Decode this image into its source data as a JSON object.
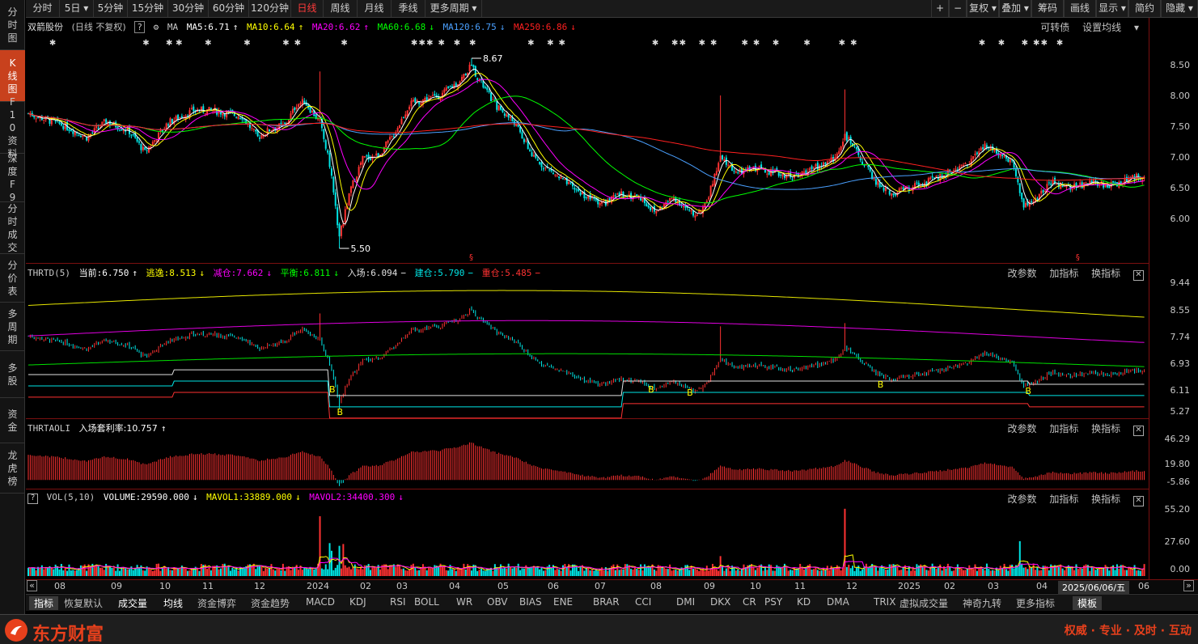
{
  "toolbar": {
    "periods": [
      "分时",
      "5日",
      "5分钟",
      "15分钟",
      "30分钟",
      "60分钟",
      "120分钟",
      "日线",
      "周线",
      "月线",
      "季线",
      "更多周期"
    ],
    "active_period": "日线",
    "right_items": [
      "+",
      "−",
      "复权",
      "叠加",
      "筹码",
      "画线",
      "显示",
      "简约",
      "隐藏"
    ]
  },
  "sidebar": [
    "分时图",
    "K线图",
    "F10资料",
    "深度F9",
    "分时成交",
    "分价表",
    "多周期",
    "多股",
    "资金",
    "龙虎榜"
  ],
  "kline": {
    "title": "双箭股份",
    "mode": "(日线 不复权)",
    "ma_label": "MA",
    "ma5": "MA5:6.71",
    "ma10": "MA10:6.64",
    "ma20": "MA20:6.62",
    "ma60": "MA60:6.68",
    "ma120": "MA120:6.75",
    "ma250": "MA250:6.86",
    "right1": "可转债",
    "right2": "设置均线",
    "high_mark": "8.67",
    "low_mark": "5.50",
    "axis": [
      "8.50",
      "8.00",
      "7.50",
      "7.00",
      "6.50",
      "6.00"
    ],
    "colors": {
      "up": "#ff3232",
      "down": "#00e5e5",
      "ma5": "#ffffff",
      "ma10": "#ffff00",
      "ma20": "#ff00ff",
      "ma60": "#00ff00",
      "ma120": "#4aa0ff",
      "ma250": "#ff2020"
    }
  },
  "thrtd": {
    "name": "THRTD(5)",
    "current": "当前:6.750",
    "escape": "逃逸:8.513",
    "reduce": "减仓:7.662",
    "balance": "平衡:6.811",
    "enter": "入场:6.094",
    "build": "建仓:5.790",
    "heavy": "重仓:5.485",
    "tools": [
      "改参数",
      "加指标",
      "换指标"
    ],
    "axis": [
      "9.44",
      "8.55",
      "7.74",
      "6.93",
      "6.11",
      "5.27"
    ],
    "b_marks": [
      "B",
      "B",
      "B",
      "B",
      "B",
      "B"
    ]
  },
  "thrtaoli": {
    "name": "THRTAOLI",
    "rate": "入场套利率:10.757",
    "tools": [
      "改参数",
      "加指标",
      "换指标"
    ],
    "axis": [
      "46.29",
      "19.80",
      "-5.86"
    ]
  },
  "vol": {
    "name": "VOL(5,10)",
    "volume": "VOLUME:29590.000",
    "mavol1": "MAVOL1:33889.000",
    "mavol2": "MAVOL2:34400.300",
    "tools": [
      "改参数",
      "加指标",
      "换指标"
    ],
    "axis": [
      "55.20",
      "27.60",
      "0.00"
    ]
  },
  "dateaxis": [
    "08",
    "09",
    "10",
    "11",
    "12",
    "2024",
    "02",
    "03",
    "04",
    "05",
    "06",
    "07",
    "08",
    "09",
    "10",
    "11",
    "12",
    "2025",
    "02",
    "03",
    "04",
    "06"
  ],
  "current_date": "2025/06/06/五",
  "indicators": [
    "指标",
    "恢复默认",
    "成交量",
    "均线",
    "资金博弈",
    "资金趋势",
    "MACD",
    "KDJ",
    "RSI",
    "BOLL",
    "WR",
    "OBV",
    "BIAS",
    "ENE",
    "BRAR",
    "CCI",
    "DMI",
    "DKX",
    "CR",
    "PSY",
    "KD",
    "DMA",
    "TRIX",
    "虚拟成交量",
    "神奇九转",
    "更多指标",
    "模板"
  ],
  "footer": {
    "brand": "东方财富",
    "slogan": "权威 · 专业 · 及时 · 互动"
  },
  "chart_data": {
    "type": "line",
    "title": "双箭股份",
    "x_range": [
      "2023-07",
      "2025-06-06"
    ],
    "ylim": [
      5.5,
      8.67
    ],
    "series": [
      {
        "name": "MA5",
        "last": 6.71
      },
      {
        "name": "MA10",
        "last": 6.64
      },
      {
        "name": "MA20",
        "last": 6.62
      },
      {
        "name": "MA60",
        "last": 6.68
      },
      {
        "name": "MA120",
        "last": 6.75
      },
      {
        "name": "MA250",
        "last": 6.86
      }
    ],
    "close_anchors": [
      [
        0,
        7.75
      ],
      [
        18,
        7.55
      ],
      [
        30,
        7.35
      ],
      [
        40,
        7.62
      ],
      [
        52,
        7.45
      ],
      [
        60,
        7.1
      ],
      [
        72,
        7.6
      ],
      [
        85,
        7.8
      ],
      [
        95,
        7.8
      ],
      [
        110,
        7.7
      ],
      [
        118,
        7.35
      ],
      [
        125,
        7.5
      ],
      [
        132,
        7.55
      ],
      [
        138,
        7.9
      ],
      [
        142,
        7.95
      ],
      [
        150,
        7.6
      ],
      [
        155,
        6.9
      ],
      [
        160,
        5.7
      ],
      [
        166,
        6.5
      ],
      [
        172,
        7.0
      ],
      [
        180,
        7.05
      ],
      [
        188,
        7.4
      ],
      [
        196,
        7.9
      ],
      [
        205,
        8.0
      ],
      [
        212,
        8.05
      ],
      [
        222,
        8.3
      ],
      [
        228,
        8.55
      ],
      [
        232,
        8.3
      ],
      [
        240,
        7.9
      ],
      [
        250,
        7.6
      ],
      [
        260,
        7.0
      ],
      [
        268,
        6.8
      ],
      [
        278,
        6.55
      ],
      [
        288,
        6.35
      ],
      [
        296,
        6.25
      ],
      [
        305,
        6.4
      ],
      [
        315,
        6.35
      ],
      [
        322,
        6.1
      ],
      [
        332,
        6.35
      ],
      [
        342,
        6.05
      ],
      [
        348,
        6.2
      ],
      [
        356,
        7.0
      ],
      [
        365,
        6.75
      ],
      [
        375,
        6.85
      ],
      [
        385,
        6.75
      ],
      [
        395,
        6.7
      ],
      [
        405,
        6.85
      ],
      [
        415,
        7.0
      ],
      [
        420,
        7.4
      ],
      [
        428,
        7.0
      ],
      [
        436,
        6.6
      ],
      [
        444,
        6.4
      ],
      [
        452,
        6.5
      ],
      [
        462,
        6.6
      ],
      [
        472,
        6.75
      ],
      [
        482,
        6.9
      ],
      [
        492,
        7.2
      ],
      [
        500,
        7.1
      ],
      [
        506,
        6.95
      ],
      [
        512,
        6.2
      ],
      [
        518,
        6.3
      ],
      [
        526,
        6.6
      ],
      [
        536,
        6.5
      ],
      [
        546,
        6.6
      ],
      [
        556,
        6.55
      ],
      [
        566,
        6.65
      ],
      [
        574,
        6.72
      ]
    ]
  }
}
